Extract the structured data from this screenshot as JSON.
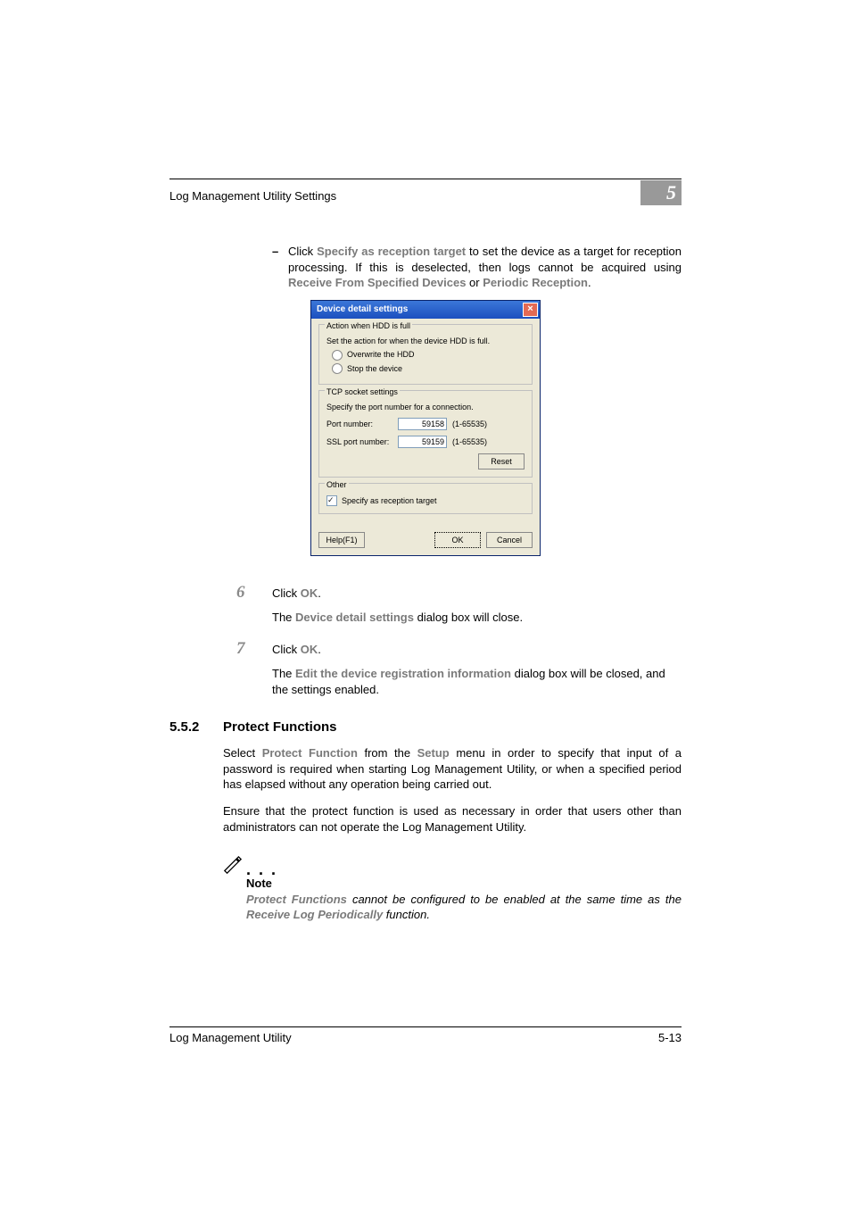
{
  "header": {
    "title": "Log Management Utility Settings",
    "chapter": "5"
  },
  "bullet": {
    "click": "Click ",
    "specify_as": "Specify as reception target",
    "part2": " to set the device as a target for reception processing. If this is deselected, then logs cannot be acquired using ",
    "receive_from": "Receive From Specified Devices",
    "or": " or ",
    "periodic": "Periodic Reception",
    "period": "."
  },
  "dlg": {
    "title": "Device detail settings",
    "close": "×",
    "group1": {
      "legend": "Action when HDD is full",
      "desc": "Set the action for when the device HDD is full.",
      "opt1": "Overwrite the HDD",
      "opt2": "Stop the device"
    },
    "group2": {
      "legend": "TCP socket settings",
      "desc": "Specify the port number for a connection.",
      "port_label": "Port number:",
      "port_value": "59158",
      "port_range": "(1-65535)",
      "ssl_label": "SSL port number:",
      "ssl_value": "59159",
      "ssl_range": "(1-65535)",
      "reset": "Reset"
    },
    "group3": {
      "legend": "Other",
      "check": "Specify as reception target"
    },
    "help": "Help(F1)",
    "ok": "OK",
    "cancel": "Cancel"
  },
  "step6": {
    "num": "6",
    "text1": "Click ",
    "ok": "OK",
    "text2": ".",
    "sub1": "The ",
    "sub_bold": "Device detail settings",
    "sub2": " dialog box will close."
  },
  "step7": {
    "num": "7",
    "text1": "Click ",
    "ok": "OK",
    "text2": ".",
    "sub1": "The ",
    "sub_bold": "Edit the device registration information",
    "sub2": " dialog box will be closed, and the settings enabled."
  },
  "section": {
    "num": "5.5.2",
    "title": "Protect Functions"
  },
  "para1": {
    "a": "Select ",
    "b": "Protect Function",
    "c": " from the ",
    "d": "Setup",
    "e": " menu in order to specify that input of a password is required when starting Log Management Utility, or when a specified period has elapsed without any operation being carried out."
  },
  "para2": "Ensure that the protect function is used as necessary in order that users other than administrators can not operate the Log Management Utility.",
  "note": {
    "label": "Note",
    "a": "Protect Functions",
    "b": " cannot be configured to be enabled at the same time as the ",
    "c": "Receive Log Periodically",
    "d": " function."
  },
  "footer": {
    "left": "Log Management Utility",
    "right": "5-13"
  }
}
